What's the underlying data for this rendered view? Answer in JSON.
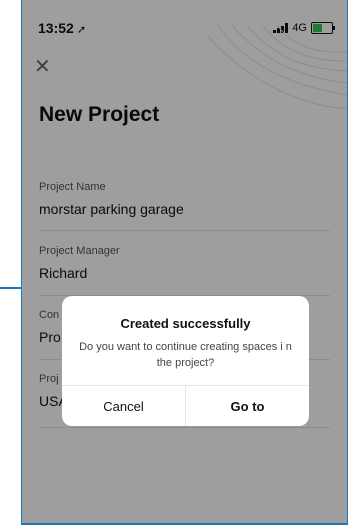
{
  "status": {
    "time": "13:52",
    "location_icon": "navigation-arrow-icon",
    "network": "4G"
  },
  "header": {
    "close_icon": "close-icon",
    "title": "New Project"
  },
  "fields": [
    {
      "label": "Project Name",
      "value": "morstar parking garage"
    },
    {
      "label": "Project Manager",
      "value": "Richard"
    },
    {
      "label": "Con",
      "value": "Pro"
    },
    {
      "label": "Proj",
      "value": "USA"
    }
  ],
  "dialog": {
    "title": "Created successfully",
    "message": "Do you want to continue creating spaces i n the project?",
    "cancel_label": "Cancel",
    "confirm_label": "Go to"
  },
  "colors": {
    "overlay": "rgba(0,0,0,0.38)",
    "battery": "#35c759",
    "frame": "#1f78b4"
  }
}
